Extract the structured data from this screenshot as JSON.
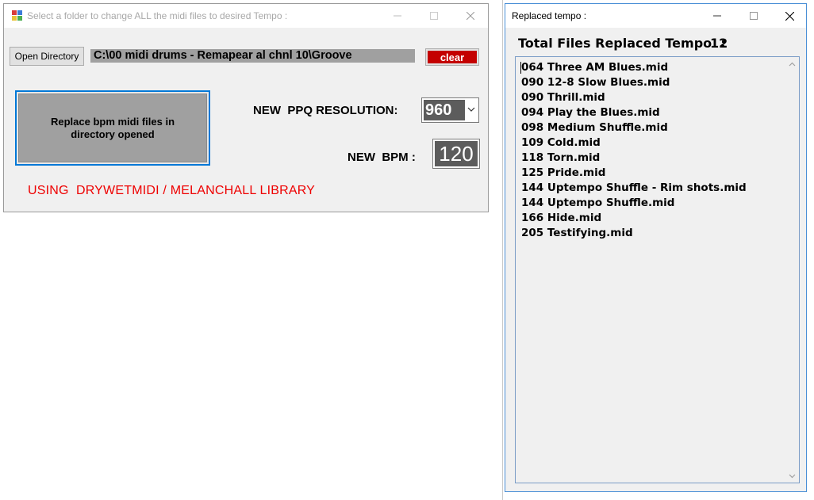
{
  "background": {
    "partial_text": "? ??? ?????????"
  },
  "window1": {
    "title": "Select a folder to change ALL the midi files to desired Tempo :",
    "open_directory_label": "Open Directory",
    "directory_path": "C:\\00 midi drums - Remapear al chnl 10\\Groove",
    "clear_label": "clear",
    "replace_button_label": "Replace bpm midi files in directory opened",
    "ppq_label": "NEW  PPQ RESOLUTION:",
    "ppq_value": "960",
    "bpm_label": "NEW  BPM :",
    "bpm_value": "120",
    "library_label": "USING  DRYWETMIDI / MELANCHALL LIBRARY",
    "colors": {
      "clear_button": "#c40000",
      "library_label": "#ee0000",
      "focus_border": "#0078d7"
    }
  },
  "window2": {
    "title": "Replaced tempo :",
    "total_label": "Total Files Replaced Tempo  :",
    "total_count": "12",
    "files": [
      "064 Three AM Blues.mid",
      "090 12-8 Slow Blues.mid",
      "090 Thrill.mid",
      "094 Play the Blues.mid",
      "098 Medium Shuffle.mid",
      "109 Cold.mid",
      "118 Torn.mid",
      "125 Pride.mid",
      "144 Uptempo Shuffle - Rim shots.mid",
      "144 Uptempo Shuffle.mid",
      "166 Hide.mid",
      "205 Testifying.mid"
    ]
  },
  "icons": [
    "app-icon",
    "minimize-icon",
    "maximize-icon",
    "close-icon",
    "dropdown-arrow-icon",
    "scroll-up-icon",
    "scroll-down-icon"
  ]
}
